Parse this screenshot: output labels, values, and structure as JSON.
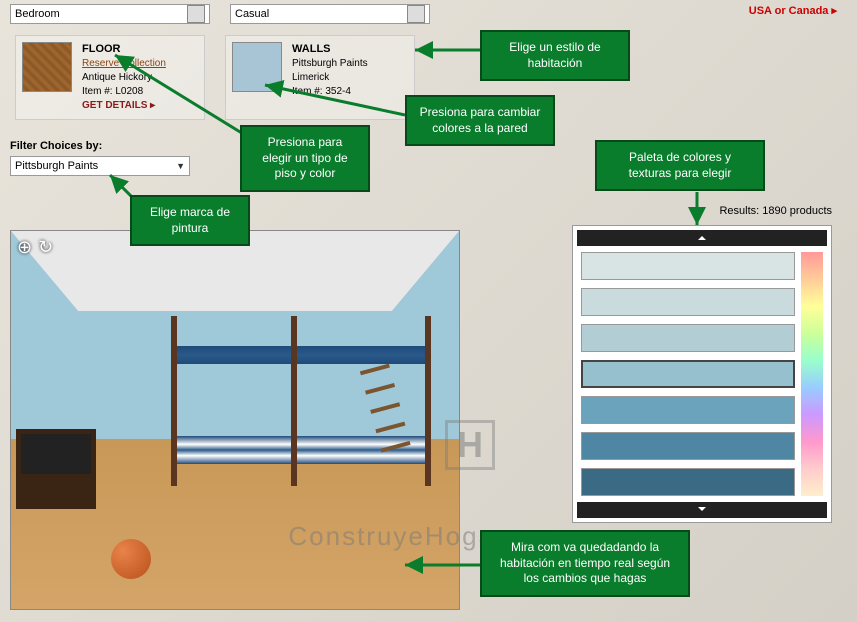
{
  "header": {
    "region_link": "USA or Canada"
  },
  "dropdowns": {
    "room": "Bedroom",
    "style": "Casual"
  },
  "floor_panel": {
    "title": "FLOOR",
    "link": "Reserve Collection",
    "name": "Antique Hickory",
    "item": "Item #: L0208",
    "cta": "GET DETAILS  ▸"
  },
  "walls_panel": {
    "title": "WALLS",
    "brand": "Pittsburgh Paints",
    "name": "Limerick",
    "item": "Item #: 352-4"
  },
  "filter": {
    "label": "Filter Choices by:",
    "value": "Pittsburgh Paints"
  },
  "callouts": {
    "style": "Elige un estilo de habitación",
    "walls": "Presiona para cambiar colores a la pared",
    "floor": "Presiona para elegir un tipo de piso y color",
    "brand": "Elige marca de pintura",
    "palette": "Paleta de colores y texturas para elegir",
    "live": "Mira com va quedadando la habitación en tiempo real según  los cambios que hagas"
  },
  "results": {
    "label": "Results:",
    "count": "1890 products"
  },
  "palette_colors": [
    "#d7e4e3",
    "#c9dbdc",
    "#b2cdd3",
    "#97c0cf",
    "#6ba3bd",
    "#4f86a3",
    "#3a6a84"
  ],
  "watermark": "ConstruyeHogar.com"
}
